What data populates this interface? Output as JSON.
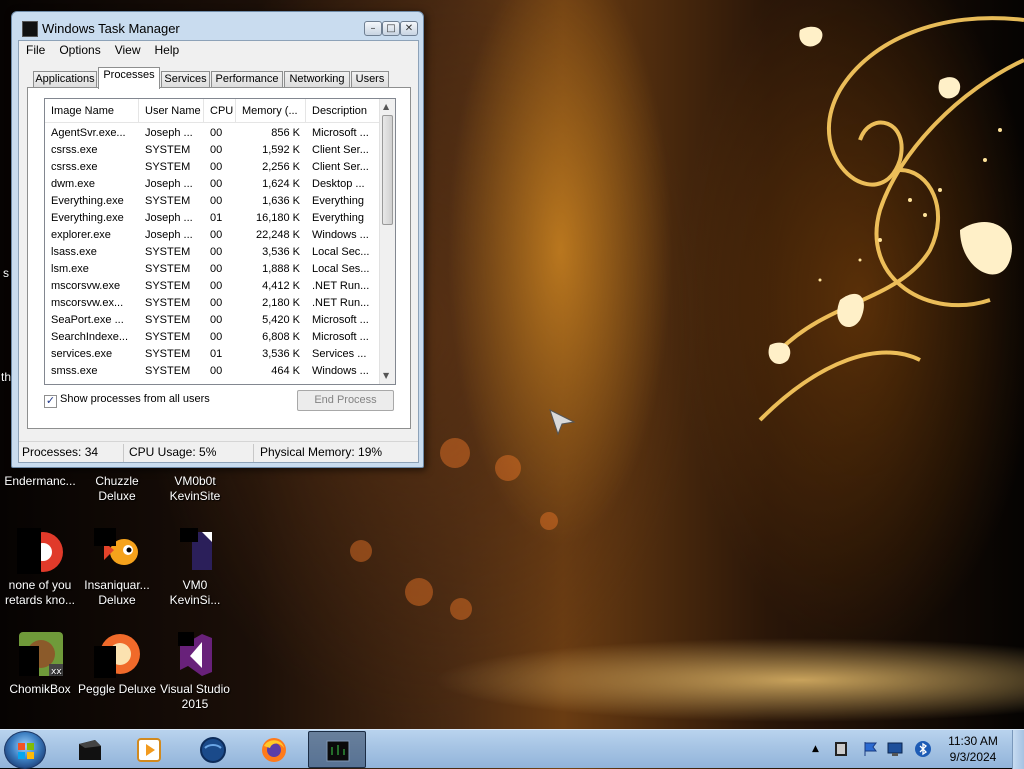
{
  "window": {
    "title": "Windows Task Manager",
    "menu": [
      "File",
      "Options",
      "View",
      "Help"
    ],
    "tabs": [
      "Applications",
      "Processes",
      "Services",
      "Performance",
      "Networking",
      "Users"
    ],
    "active_tab": "Processes",
    "columns": [
      "Image Name",
      "User Name",
      "CPU",
      "Memory (...",
      "Description"
    ],
    "rows": [
      [
        "AgentSvr.exe...",
        "Joseph ...",
        "00",
        "856 K",
        "Microsoft ..."
      ],
      [
        "csrss.exe",
        "SYSTEM",
        "00",
        "1,592 K",
        "Client Ser..."
      ],
      [
        "csrss.exe",
        "SYSTEM",
        "00",
        "2,256 K",
        "Client Ser..."
      ],
      [
        "dwm.exe",
        "Joseph ...",
        "00",
        "1,624 K",
        "Desktop ..."
      ],
      [
        "Everything.exe",
        "SYSTEM",
        "00",
        "1,636 K",
        "Everything"
      ],
      [
        "Everything.exe",
        "Joseph ...",
        "01",
        "16,180 K",
        "Everything"
      ],
      [
        "explorer.exe",
        "Joseph ...",
        "00",
        "22,248 K",
        "Windows ..."
      ],
      [
        "lsass.exe",
        "SYSTEM",
        "00",
        "3,536 K",
        "Local Sec..."
      ],
      [
        "lsm.exe",
        "SYSTEM",
        "00",
        "1,888 K",
        "Local Ses..."
      ],
      [
        "mscorsvw.exe",
        "SYSTEM",
        "00",
        "4,412 K",
        ".NET Run..."
      ],
      [
        "mscorsvw.ex...",
        "SYSTEM",
        "00",
        "2,180 K",
        ".NET Run..."
      ],
      [
        "SeaPort.exe ...",
        "SYSTEM",
        "00",
        "5,420 K",
        "Microsoft ..."
      ],
      [
        "SearchIndexe...",
        "SYSTEM",
        "00",
        "6,808 K",
        "Microsoft ..."
      ],
      [
        "services.exe",
        "SYSTEM",
        "01",
        "3,536 K",
        "Services ..."
      ],
      [
        "smss.exe",
        "SYSTEM",
        "00",
        "464 K",
        "Windows ..."
      ]
    ],
    "show_all_label": "Show processes from all users",
    "show_all_checked": true,
    "end_process_label": "End Process",
    "status": {
      "processes": "Processes: 34",
      "cpu": "CPU Usage: 5%",
      "memory": "Physical Memory: 19%"
    }
  },
  "desktop": {
    "edge_fragments": [
      "s",
      "th"
    ],
    "icons": [
      {
        "label": "Endermanc...",
        "icon": "app-icon"
      },
      {
        "label": "Chuzzle\nDeluxe",
        "icon": "game-icon"
      },
      {
        "label": "VM0b0t\nKevinSite",
        "icon": "file-icon"
      },
      {
        "label": "none of you\nretards kno...",
        "icon": "chrome-like-icon"
      },
      {
        "label": "Insaniquar...\nDeluxe",
        "icon": "fish-game-icon"
      },
      {
        "label": "VM0\nKevinSi...",
        "icon": "document-icon"
      },
      {
        "label": "ChomikBox",
        "icon": "hamster-icon"
      },
      {
        "label": "Peggle Deluxe",
        "icon": "peggle-icon"
      },
      {
        "label": "Visual Studio\n2015",
        "icon": "visual-studio-icon"
      }
    ]
  },
  "taskbar": {
    "items": [
      "media-app-icon",
      "media-player-icon",
      "browser-globe-icon",
      "firefox-icon",
      "task-manager-icon"
    ],
    "clock_time": "11:30 AM",
    "clock_date": "9/3/2024"
  },
  "colors": {
    "title_bar": "#c9dcef",
    "taskbar": "#a6c4e4",
    "check_mark": "#22398a"
  }
}
